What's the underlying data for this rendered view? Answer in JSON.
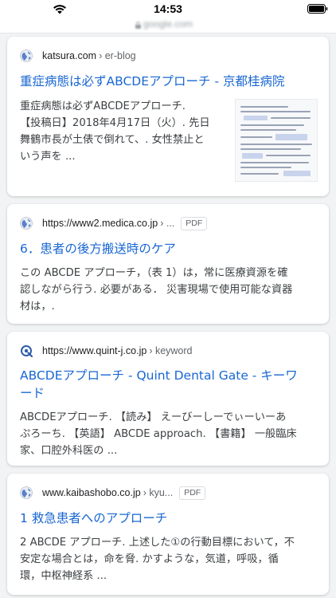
{
  "status": {
    "time": "14:53"
  },
  "browser": {
    "url": "google.com"
  },
  "results": [
    {
      "url": "katsura.com",
      "path": "› er-blog",
      "title": "重症病態は必ずABCDEアプローチ - 京都桂病院",
      "snippet": [
        "重症病態は必ずABCDEアプローチ.",
        "【投稿日】2018年4月17日（火）. 先日",
        "舞鶴市長が土俵で倒れて、. 女性禁止と",
        "いう声を ..."
      ],
      "has_pdf": false
    },
    {
      "url": "https://www2.medica.co.jp",
      "path": "› ...",
      "badge": "PDF",
      "title": "6．患者の後方搬送時のケア",
      "snippet": [
        "この ABCDE アプローチ，（表 1）は，常に医療資源を確",
        "認しながら行う. 必要がある．  災害現場で使用可能な資器",
        "材は，."
      ],
      "has_pdf": true
    },
    {
      "url": "https://www.quint-j.co.jp",
      "path": "› keyword",
      "title": "ABCDEアプローチ - Quint Dental Gate - キーワード",
      "snippet": [
        "ABCDEアプローチ. 【読み】 えーびーしーでぃーいーあ",
        "ぷろーち. 【英語】 ABCDE approach. 【書籍】 一般臨床",
        "家、口腔外科医の ..."
      ],
      "has_pdf": false
    },
    {
      "url": "www.kaibashobo.co.jp",
      "path": "› kyu...",
      "badge": "PDF",
      "title": "1 救急患者へのアプローチ",
      "snippet": [
        "2 ABCDE アプローチ. 上述した①の行動目標において，不",
        "安定な場合とは，命を脅. かすような，気道，呼吸，循",
        "環，中枢神経系 ..."
      ],
      "has_pdf": true
    }
  ],
  "icons": {
    "globe": "globe-icon",
    "quint": "quint-logo-icon",
    "wifi": "wifi-icon",
    "battery": "battery-icon",
    "lock": "lock-icon"
  },
  "colors": {
    "link": "#1a0dab",
    "link_alt": "#1967d2",
    "background": "#f1f3f4",
    "card": "#ffffff"
  }
}
